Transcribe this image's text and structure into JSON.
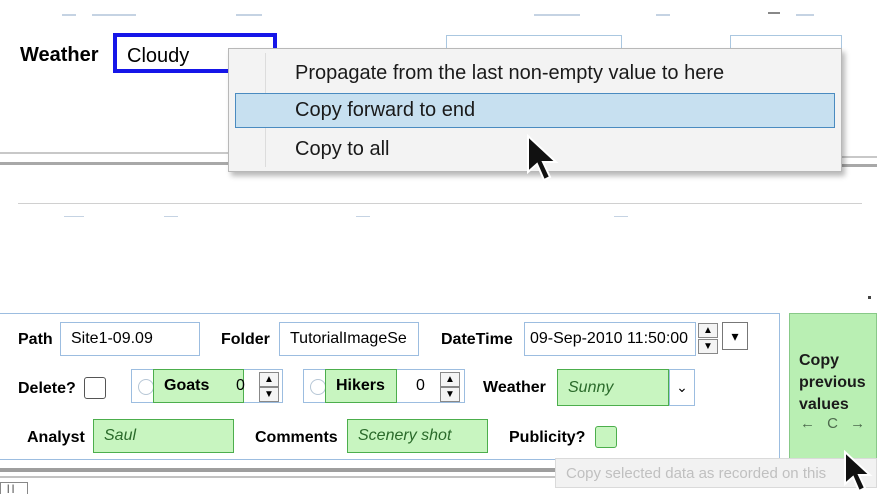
{
  "top_row": {
    "weather_label": "Weather",
    "weather_value": "Cloudy"
  },
  "context_menu": {
    "items": [
      {
        "label": "Propagate from the last non-empty value to here",
        "highlighted": false
      },
      {
        "label": "Copy forward to end",
        "highlighted": true
      },
      {
        "label": "Copy to all",
        "highlighted": false
      }
    ]
  },
  "panel": {
    "path_label": "Path",
    "path_value": "Site1-09.09",
    "folder_label": "Folder",
    "folder_value": "TutorialImageSe",
    "datetime_label": "DateTime",
    "datetime_value": "09-Sep-2010 11:50:00",
    "delete_label": "Delete?",
    "goats_label": "Goats",
    "goats_value": "0",
    "hikers_label": "Hikers",
    "hikers_value": "0",
    "weather_label": "Weather",
    "weather_value": "Sunny",
    "analyst_label": "Analyst",
    "analyst_value": "Saul",
    "comments_label": "Comments",
    "comments_value": "Scenery shot",
    "publicity_label": "Publicity?"
  },
  "copy_previous": {
    "line1": "Copy",
    "line2": "previous",
    "line3": "values",
    "arrows": "← C →"
  },
  "tooltip": {
    "text": "Copy selected data as recorded on this"
  },
  "colors": {
    "focus_border": "#1616e8",
    "menu_highlight": "#c7e0f0",
    "copied_field": "#c8f5c0",
    "copy_button": "#b9efb3"
  }
}
